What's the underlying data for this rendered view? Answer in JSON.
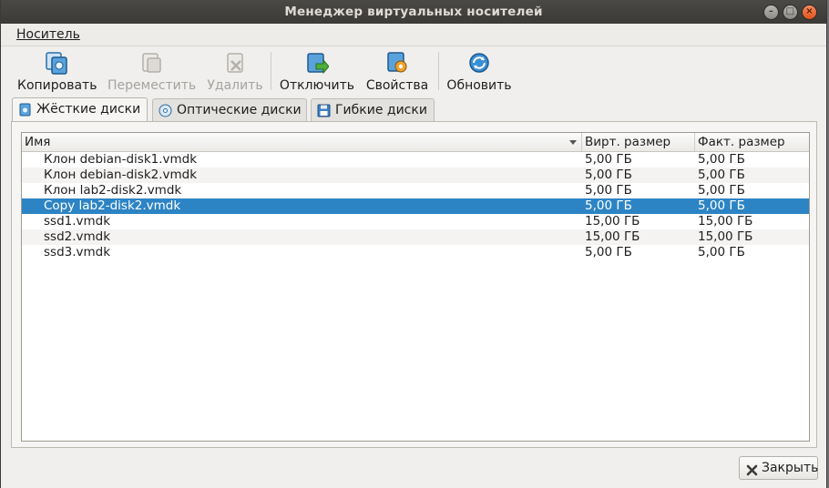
{
  "window": {
    "title": "Менеджер виртуальных носителей"
  },
  "menubar": {
    "items": [
      {
        "label": "Носитель"
      }
    ]
  },
  "toolbar": {
    "buttons": [
      {
        "label": "Копировать",
        "icon": "copy-disk-icon",
        "enabled": true
      },
      {
        "label": "Переместить",
        "icon": "move-disk-icon",
        "enabled": false
      },
      {
        "label": "Удалить",
        "icon": "remove-disk-icon",
        "enabled": false
      },
      {
        "label": "Отключить",
        "icon": "release-disk-icon",
        "enabled": true
      },
      {
        "label": "Свойства",
        "icon": "properties-icon",
        "enabled": true
      },
      {
        "label": "Обновить",
        "icon": "refresh-icon",
        "enabled": true
      }
    ]
  },
  "tabs": [
    {
      "label": "Жёсткие диски",
      "icon": "hard-disk-icon",
      "active": true
    },
    {
      "label": "Оптические диски",
      "icon": "optical-disk-icon",
      "active": false
    },
    {
      "label": "Гибкие диски",
      "icon": "floppy-disk-icon",
      "active": false
    }
  ],
  "table": {
    "columns": [
      "Имя",
      "Вирт. размер",
      "Факт. размер"
    ],
    "rows": [
      {
        "name": "Клон debian-disk1.vmdk",
        "virtual": "5,00 ГБ",
        "actual": "5,00 ГБ",
        "selected": false
      },
      {
        "name": "Клон debian-disk2.vmdk",
        "virtual": "5,00 ГБ",
        "actual": "5,00 ГБ",
        "selected": false
      },
      {
        "name": "Клон lab2-disk2.vmdk",
        "virtual": "5,00 ГБ",
        "actual": "5,00 ГБ",
        "selected": false
      },
      {
        "name": "Copy lab2-disk2.vmdk",
        "virtual": "5,00 ГБ",
        "actual": "5,00 ГБ",
        "selected": true
      },
      {
        "name": "ssd1.vmdk",
        "virtual": "15,00 ГБ",
        "actual": "15,00 ГБ",
        "selected": false
      },
      {
        "name": "ssd2.vmdk",
        "virtual": "15,00 ГБ",
        "actual": "15,00 ГБ",
        "selected": false
      },
      {
        "name": "ssd3.vmdk",
        "virtual": "5,00 ГБ",
        "actual": "5,00 ГБ",
        "selected": false
      }
    ]
  },
  "footer": {
    "close_label": "Закрыть"
  },
  "colors": {
    "selection": "#2d84c4",
    "titlebar": "#3d3c38"
  }
}
